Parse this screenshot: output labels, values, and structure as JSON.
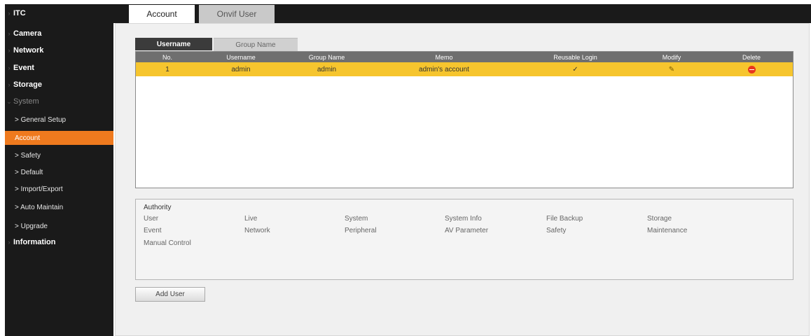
{
  "sidebar": {
    "items": [
      {
        "label": "ITC"
      },
      {
        "label": "Camera"
      },
      {
        "label": "Network"
      },
      {
        "label": "Event"
      },
      {
        "label": "Storage"
      },
      {
        "label": "System"
      },
      {
        "label": "> General Setup"
      },
      {
        "label": "Account"
      },
      {
        "label": "> Safety"
      },
      {
        "label": "> Default"
      },
      {
        "label": "> Import/Export"
      },
      {
        "label": "> Auto Maintain"
      },
      {
        "label": "> Upgrade"
      },
      {
        "label": "Information"
      }
    ]
  },
  "top_tabs": {
    "account": "Account",
    "onvif": "Onvif User"
  },
  "sub_tabs": {
    "username": "Username",
    "group": "Group Name"
  },
  "table": {
    "headers": [
      "No.",
      "Username",
      "Group Name",
      "Memo",
      "Reusable Login",
      "Modify",
      "Delete"
    ],
    "rows": [
      {
        "no": "1",
        "username": "admin",
        "group": "admin",
        "memo": "admin's account",
        "reusable": "✓"
      }
    ]
  },
  "authority": {
    "title": "Authority",
    "items": [
      "User",
      "Live",
      "System",
      "System Info",
      "File Backup",
      "Storage",
      "Event",
      "Network",
      "Peripheral",
      "AV Parameter",
      "Safety",
      "Maintenance",
      "Manual Control"
    ]
  },
  "add_user_label": "Add User",
  "colors": {
    "accent": "#ef7a1e",
    "selected_row": "#f6c52e",
    "sidebar_bg": "#1a1a1a"
  },
  "icons": {
    "modify": "edit-icon",
    "delete": "delete-icon"
  }
}
